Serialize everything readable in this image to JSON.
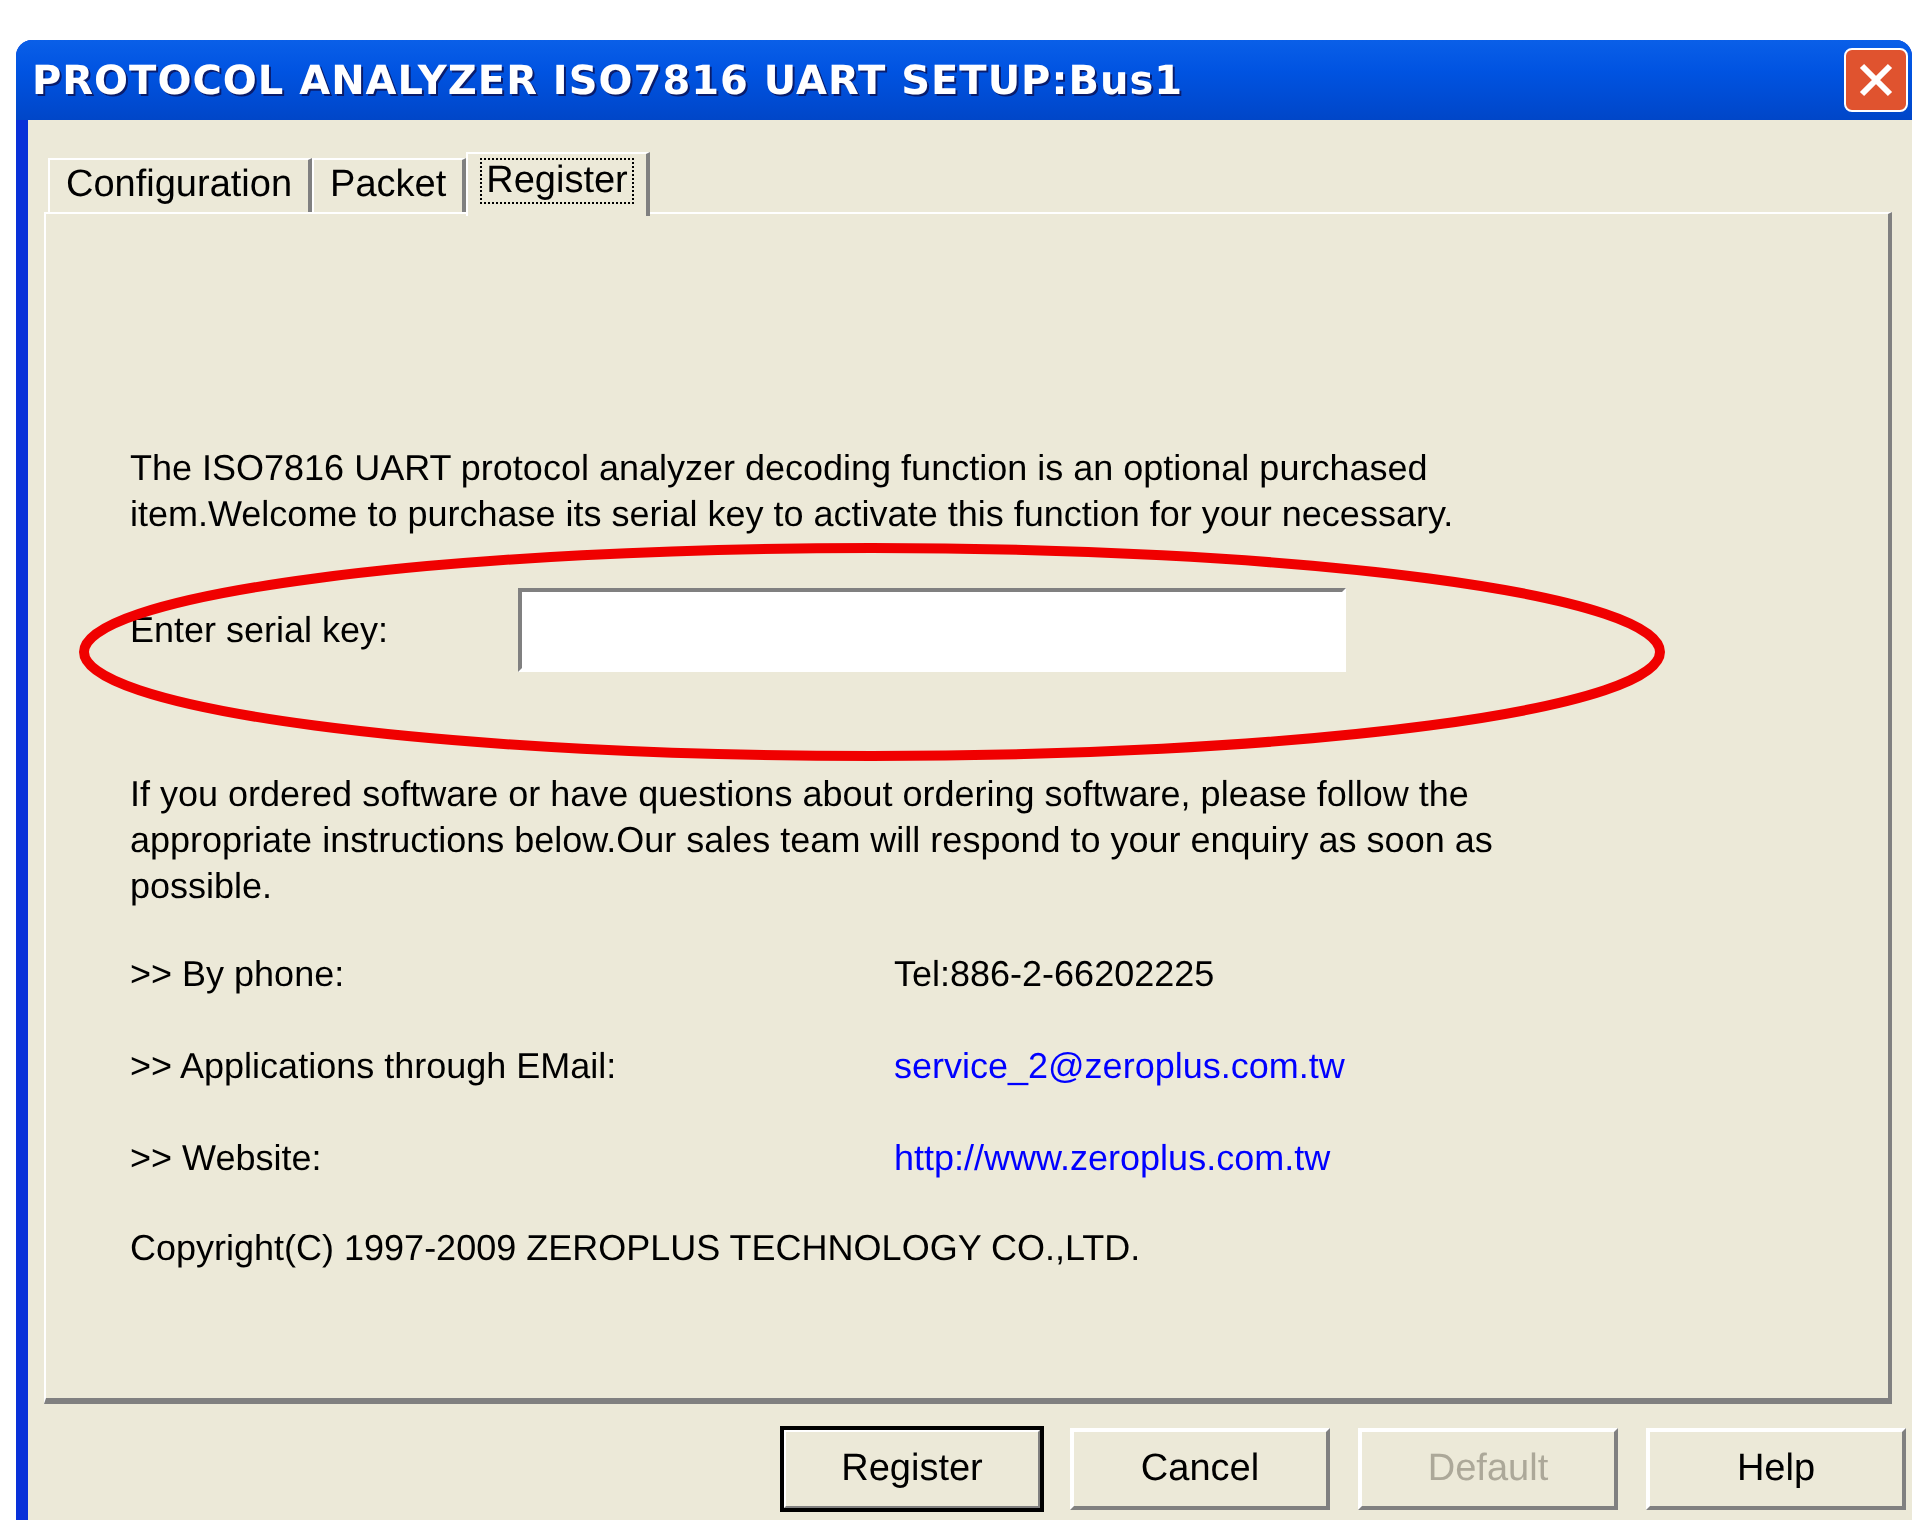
{
  "window": {
    "title": "PROTOCOL ANALYZER ISO7816 UART SETUP:Bus1"
  },
  "tabs": [
    {
      "label": "Configuration",
      "selected": false
    },
    {
      "label": "Packet",
      "selected": false
    },
    {
      "label": "Register",
      "selected": true
    }
  ],
  "register": {
    "intro": "The ISO7816 UART protocol analyzer decoding function is an optional purchased item.Welcome to purchase its serial key to activate this function for your necessary.",
    "serial_label": "Enter serial key:",
    "info": "If you ordered software or have questions about ordering software, please follow the appropriate instructions below.Our sales team will respond to your enquiry as soon as possible.",
    "contacts": [
      {
        "label": ">> By phone:",
        "value": "Tel:886-2-66202225",
        "kind": "text"
      },
      {
        "label": ">> Applications through EMail:",
        "value": "service_2@zeroplus.com.tw",
        "kind": "link"
      },
      {
        "label": ">> Website:",
        "value": "http://www.zeroplus.com.tw",
        "kind": "link"
      }
    ],
    "copyright": "Copyright(C) 1997-2009 ZEROPLUS TECHNOLOGY CO.,LTD."
  },
  "buttons": [
    {
      "label": "Register",
      "disabled": false,
      "default": true
    },
    {
      "label": "Cancel",
      "disabled": false,
      "default": false
    },
    {
      "label": "Default",
      "disabled": true,
      "default": false
    },
    {
      "label": "Help",
      "disabled": false,
      "default": false
    }
  ]
}
